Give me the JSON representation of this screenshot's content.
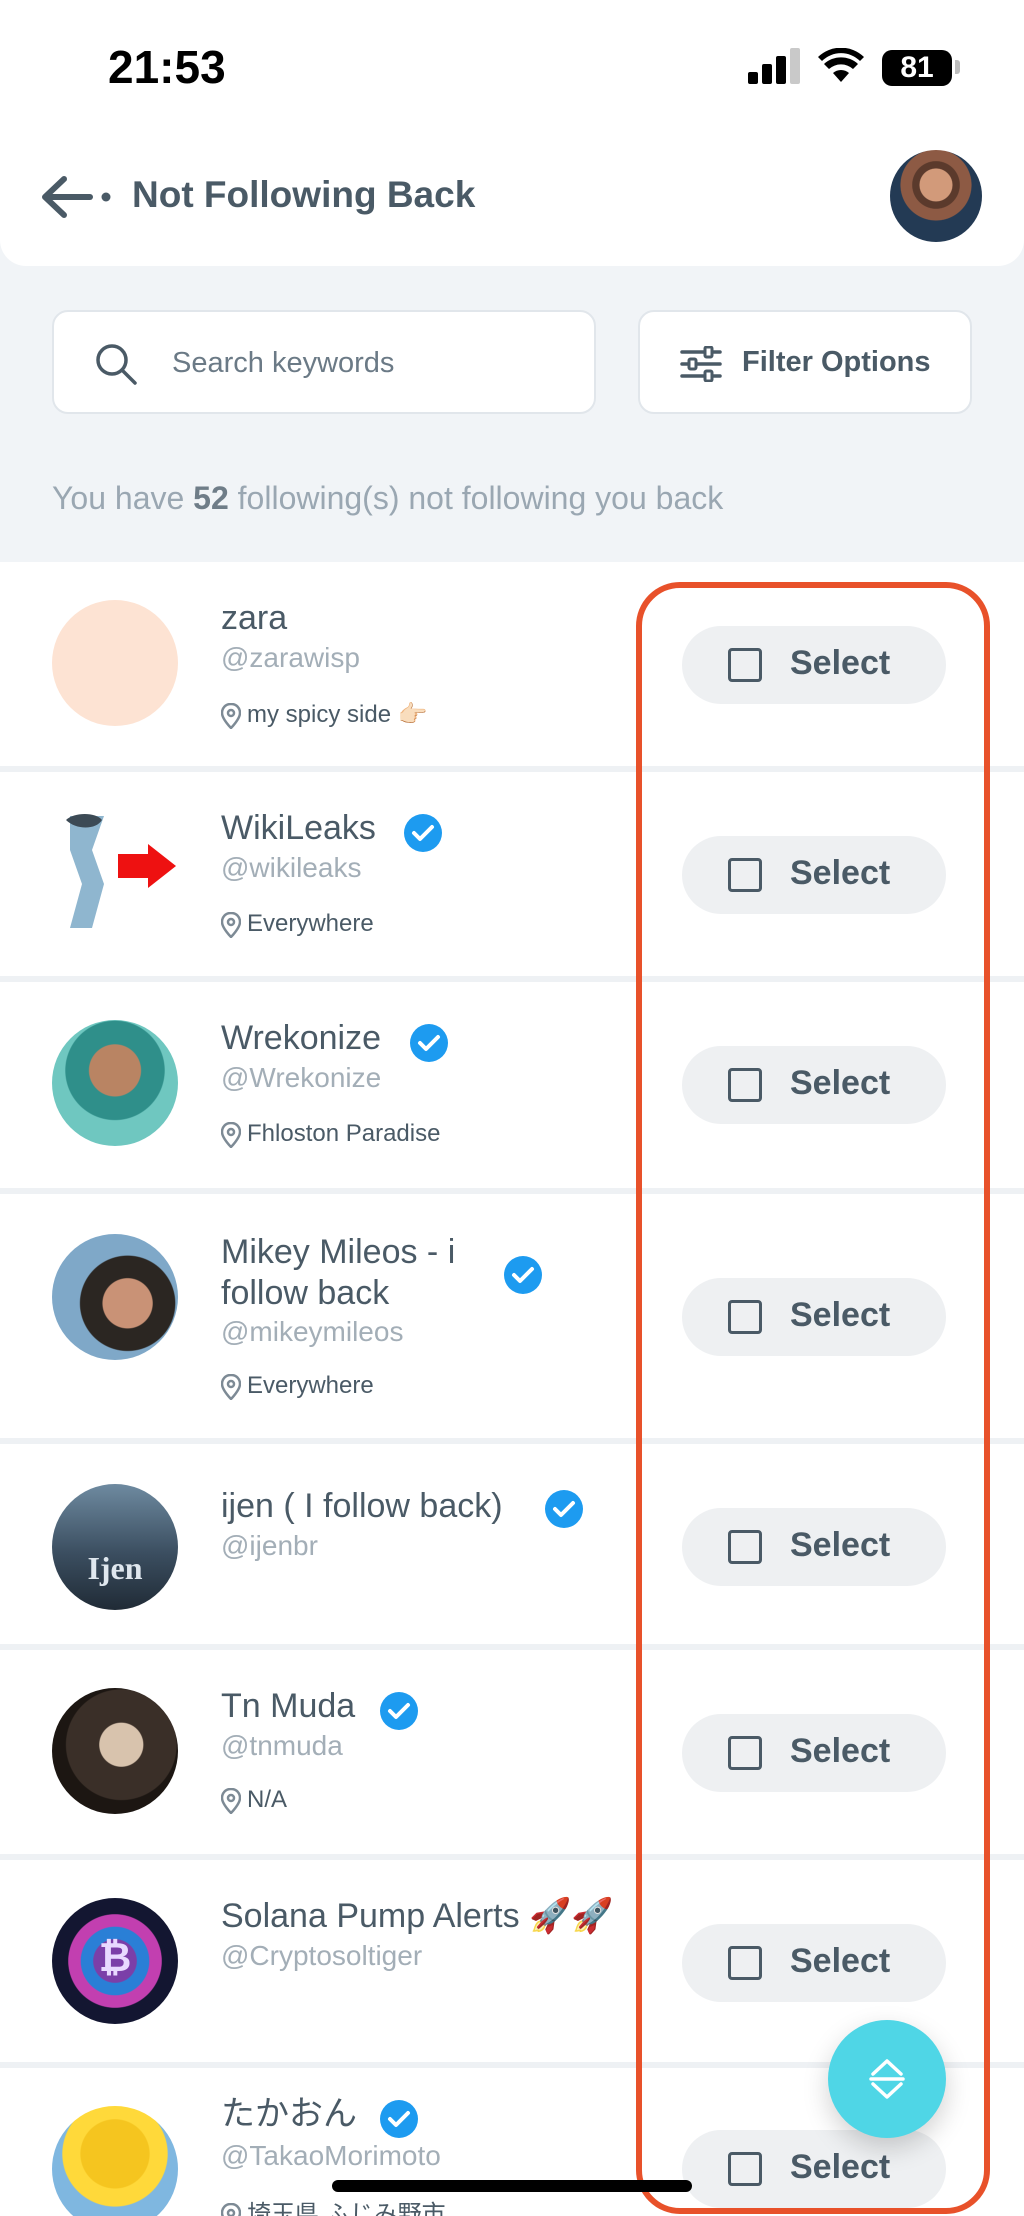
{
  "status_bar": {
    "time": "21:53",
    "battery": "81"
  },
  "header": {
    "title": "Not Following Back"
  },
  "search": {
    "placeholder": "Search keywords"
  },
  "filter": {
    "label": "Filter Options"
  },
  "summary": {
    "prefix": "You have ",
    "count": "52",
    "suffix": " following(s) not following you back"
  },
  "select_label": "Select",
  "users": [
    {
      "name": "zara",
      "handle": "@zarawisp",
      "location": "my spicy side 👉🏻",
      "verified": false
    },
    {
      "name": "WikiLeaks",
      "handle": "@wikileaks",
      "location": "Everywhere",
      "verified": true
    },
    {
      "name": "Wrekonize",
      "handle": "@Wrekonize",
      "location": "Fhloston Paradise",
      "verified": true
    },
    {
      "name": "Mikey Mileos - i follow back",
      "handle": "@mikeymileos",
      "location": "Everywhere",
      "verified": true
    },
    {
      "name": "ijen ( I follow back)",
      "handle": "@ijenbr",
      "location": "",
      "verified": true
    },
    {
      "name": "Tn Muda",
      "handle": "@tnmuda",
      "location": "N/A",
      "verified": true
    },
    {
      "name": "Solana Pump Alerts 🚀🚀",
      "handle": "@Cryptosoltiger",
      "location": "",
      "verified": false
    },
    {
      "name": "たかおん",
      "handle": "@TakaoMorimoto",
      "location": "埼玉県 ふじみ野市",
      "verified": true
    }
  ],
  "avatar_text": {
    "ijen": "Ijen"
  },
  "colors": {
    "accent": "#4fd6e6",
    "highlight": "#e8512a",
    "verified": "#1d9bf0"
  }
}
